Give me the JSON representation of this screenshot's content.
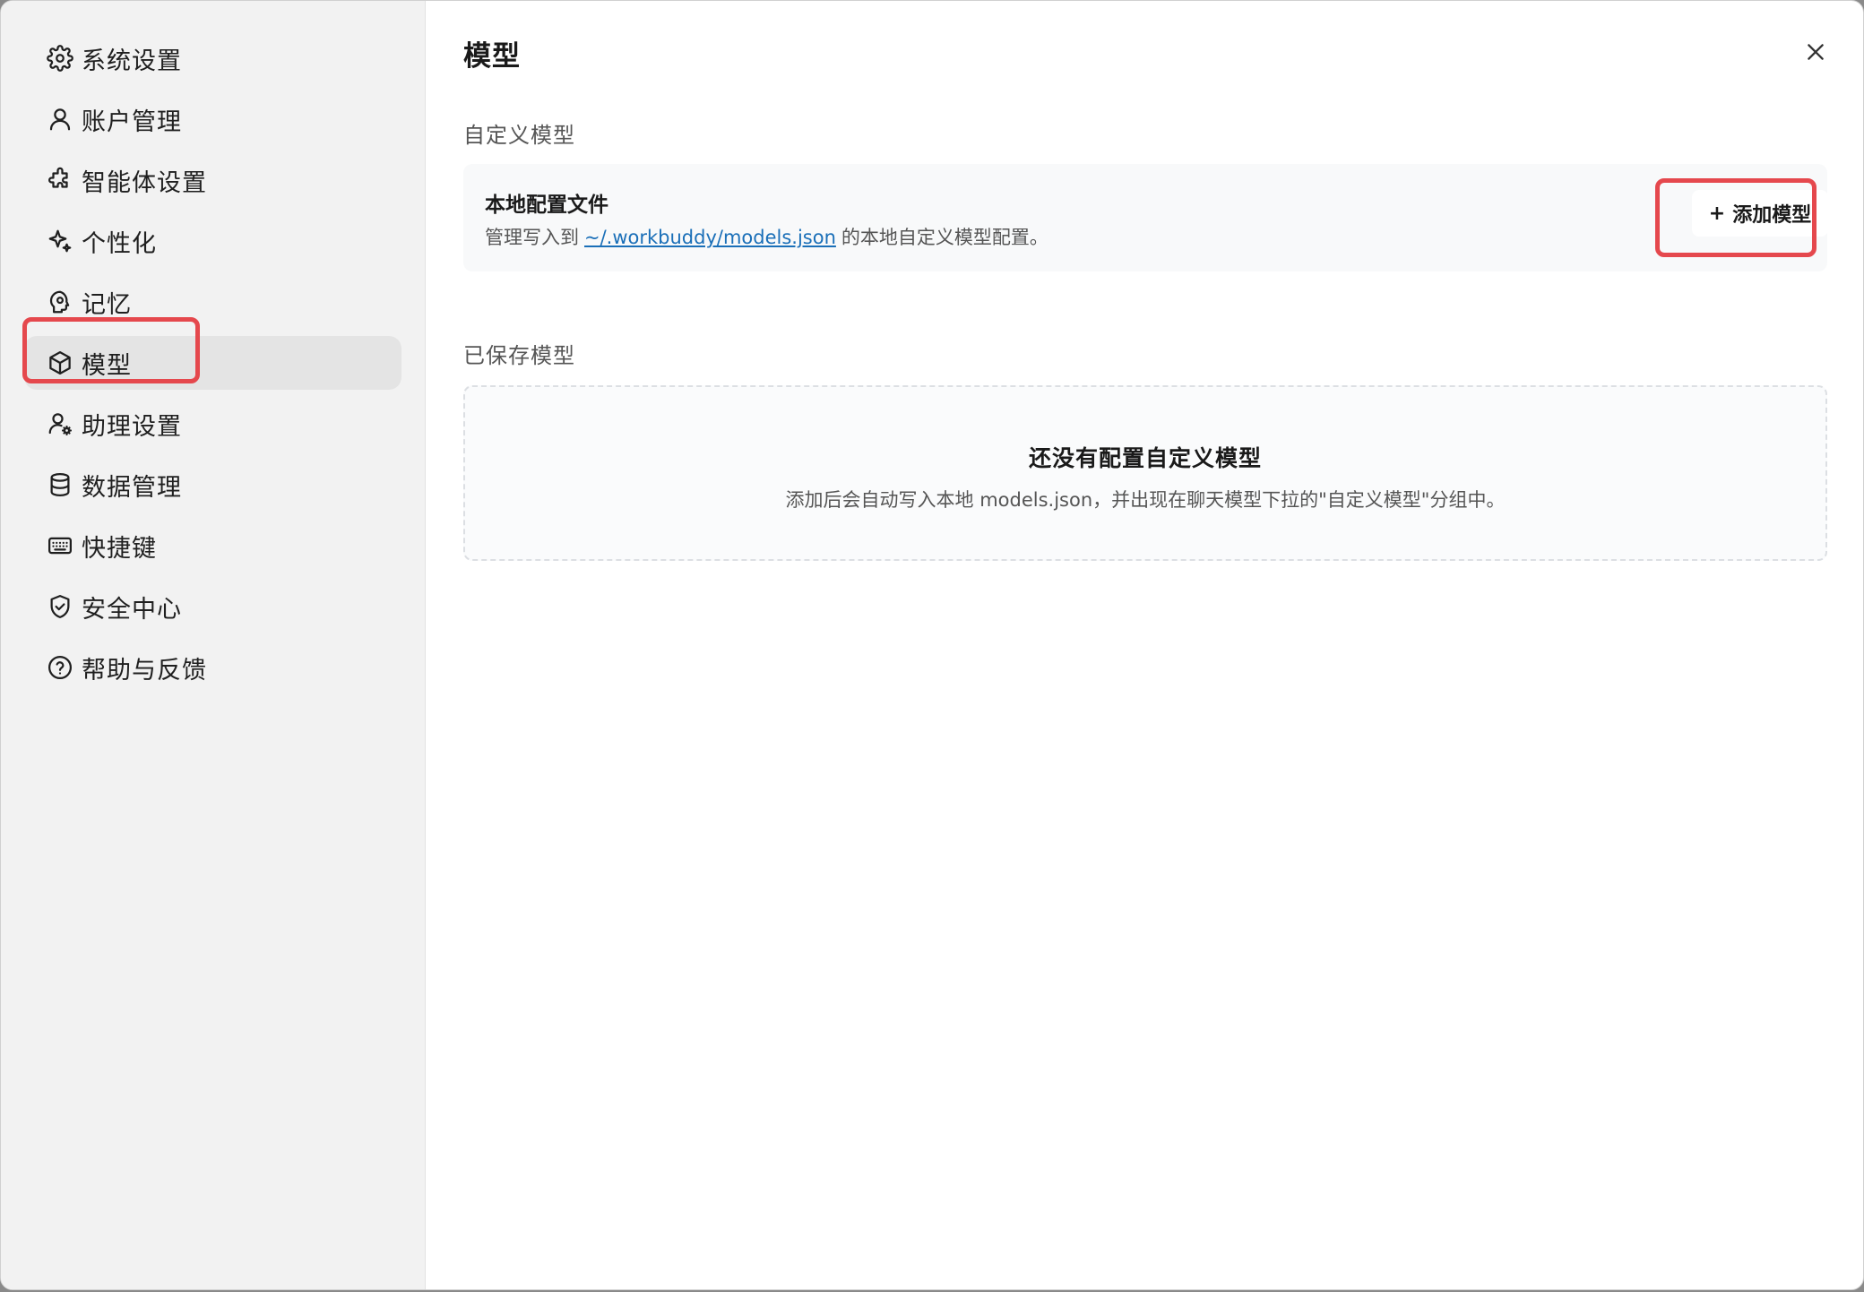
{
  "sidebar": {
    "items": [
      {
        "id": "system",
        "label": "系统设置",
        "icon": "gear-icon"
      },
      {
        "id": "account",
        "label": "账户管理",
        "icon": "user-icon"
      },
      {
        "id": "agent",
        "label": "智能体设置",
        "icon": "puzzle-icon"
      },
      {
        "id": "personalize",
        "label": "个性化",
        "icon": "sparkle-icon"
      },
      {
        "id": "memory",
        "label": "记忆",
        "icon": "brain-icon"
      },
      {
        "id": "model",
        "label": "模型",
        "icon": "cube-icon",
        "active": true
      },
      {
        "id": "assistant",
        "label": "助理设置",
        "icon": "user-gear-icon"
      },
      {
        "id": "data",
        "label": "数据管理",
        "icon": "database-icon"
      },
      {
        "id": "shortcut",
        "label": "快捷键",
        "icon": "keyboard-icon"
      },
      {
        "id": "security",
        "label": "安全中心",
        "icon": "shield-check-icon"
      },
      {
        "id": "help",
        "label": "帮助与反馈",
        "icon": "help-circle-icon"
      }
    ]
  },
  "main": {
    "title": "模型",
    "custom_section": {
      "heading": "自定义模型",
      "card_title": "本地配置文件",
      "desc_prefix": "管理写入到",
      "desc_link": "~/.workbuddy/models.json",
      "desc_suffix": "的本地自定义模型配置。",
      "add_button": {
        "plus": "+",
        "label": "添加模型"
      }
    },
    "saved_section": {
      "heading": "已保存模型",
      "empty_title": "还没有配置自定义模型",
      "empty_desc": "添加后会自动写入本地 models.json，并出现在聊天模型下拉的\"自定义模型\"分组中。"
    }
  },
  "colors": {
    "highlight": "#e5484d",
    "link": "#1a6fb8",
    "sidebar_bg": "#f2f2f2",
    "active_item_bg": "#e4e4e4"
  }
}
